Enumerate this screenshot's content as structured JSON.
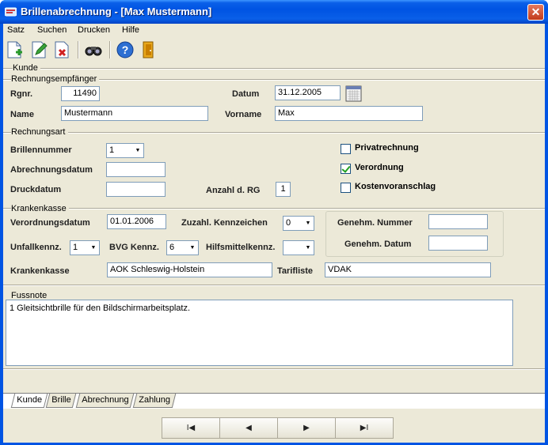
{
  "window": {
    "title": "Brillenabrechnung - [Max Mustermann]",
    "close_glyph": "✕"
  },
  "menu": [
    {
      "label": "Satz"
    },
    {
      "label": "Suchen"
    },
    {
      "label": "Drucken"
    },
    {
      "label": "Hilfe"
    }
  ],
  "toolbar": {
    "icons": [
      "new-document-icon",
      "edit-document-icon",
      "delete-document-icon",
      "binoculars-icon",
      "help-icon",
      "exit-door-icon"
    ],
    "help_glyph": "?"
  },
  "sections": {
    "kunde": "Kunde",
    "rechnungsempfaenger": "Rechnungsempfänger",
    "rechnungsart": "Rechnungsart",
    "krankenkasse": "Krankenkasse",
    "fussnote": "Fussnote"
  },
  "recipient": {
    "rgnr_label": "Rgnr.",
    "rgnr_value": "11490",
    "datum_label": "Datum",
    "datum_value": "31.12.2005",
    "name_label": "Name",
    "name_value": "Mustermann",
    "vorname_label": "Vorname",
    "vorname_value": "Max"
  },
  "billing": {
    "brillennummer_label": "Brillennummer",
    "brillennummer_value": "1",
    "abrechnungsdatum_label": "Abrechnungsdatum",
    "abrechnungsdatum_value": "",
    "druckdatum_label": "Druckdatum",
    "druckdatum_value": "",
    "anzahl_label": "Anzahl d. RG",
    "anzahl_value": "1",
    "privatrechnung_label": "Privatrechnung",
    "privatrechnung_checked": false,
    "verordnung_label": "Verordnung",
    "verordnung_checked": true,
    "kostenvoranschlag_label": "Kostenvoranschlag",
    "kostenvoranschlag_checked": false
  },
  "insurance": {
    "verordnungsdatum_label": "Verordnungsdatum",
    "verordnungsdatum_value": "01.01.2006",
    "zuzahl_label": "Zuzahl. Kennzeichen",
    "zuzahl_value": "0",
    "unfall_label": "Unfallkennz.",
    "unfall_value": "1",
    "bvg_label": "BVG Kennz.",
    "bvg_value": "6",
    "hilfsmittel_label": "Hilfsmittelkennz.",
    "hilfsmittel_value": "",
    "genehm_nummer_label": "Genehm. Nummer",
    "genehm_nummer_value": "",
    "genehm_datum_label": "Genehm. Datum",
    "genehm_datum_value": "",
    "krankenkasse_label": "Krankenkasse",
    "krankenkasse_value": "AOK Schleswig-Holstein",
    "tarifliste_label": "Tarifliste",
    "tarifliste_value": "VDAK"
  },
  "footnote": {
    "text": "1 Gleitsichtbrille für den Bildschirmarbeitsplatz."
  },
  "tabs": [
    {
      "label": "Kunde",
      "active": true
    },
    {
      "label": "Brille",
      "active": false
    },
    {
      "label": "Abrechnung",
      "active": false
    },
    {
      "label": "Zahlung",
      "active": false
    }
  ],
  "navigation": {
    "first": "I◀",
    "prev": "◀",
    "next": "▶",
    "last": "▶I"
  }
}
